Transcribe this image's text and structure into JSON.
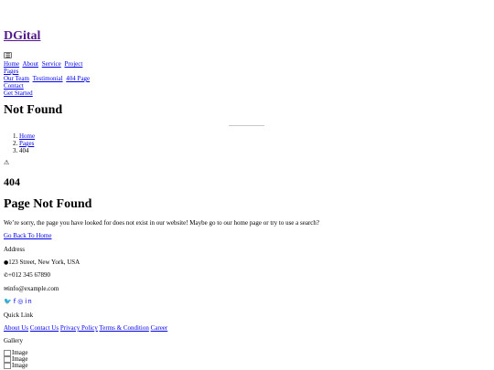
{
  "brand": "DGital",
  "toggler_icon": "☰",
  "nav": {
    "items": [
      "Home",
      "About",
      "Service",
      "Project"
    ],
    "pages": "Pages",
    "dropdown": [
      "Our Team",
      "Testimonial",
      "404 Page"
    ],
    "contact": "Contact",
    "cta": "Get Started"
  },
  "header": {
    "title": "Not Found",
    "breadcrumb": [
      {
        "n": "1.",
        "label": "Home"
      },
      {
        "n": "2.",
        "label": "Pages"
      },
      {
        "n": "3.",
        "label": "404"
      }
    ]
  },
  "error": {
    "warning_icon": "⚠",
    "code": "404",
    "title": "Page Not Found",
    "message": "We’re sorry, the page you have looked for does not exist in our website! Maybe go to our home page or try to use a search?",
    "button": "Go Back To Home"
  },
  "footer": {
    "address_heading": "Address",
    "address": "123 Street, New York, USA",
    "phone": "+012 345 67890",
    "email": "info@example.com",
    "quick_link_heading": "Quick Link",
    "quick_links": [
      "About Us",
      "Contact Us",
      "Privacy Policy",
      "Terms & Condition",
      "Career"
    ],
    "gallery_heading": "Gallery",
    "gallery_alt": [
      "Image",
      "Image",
      "Image"
    ]
  }
}
